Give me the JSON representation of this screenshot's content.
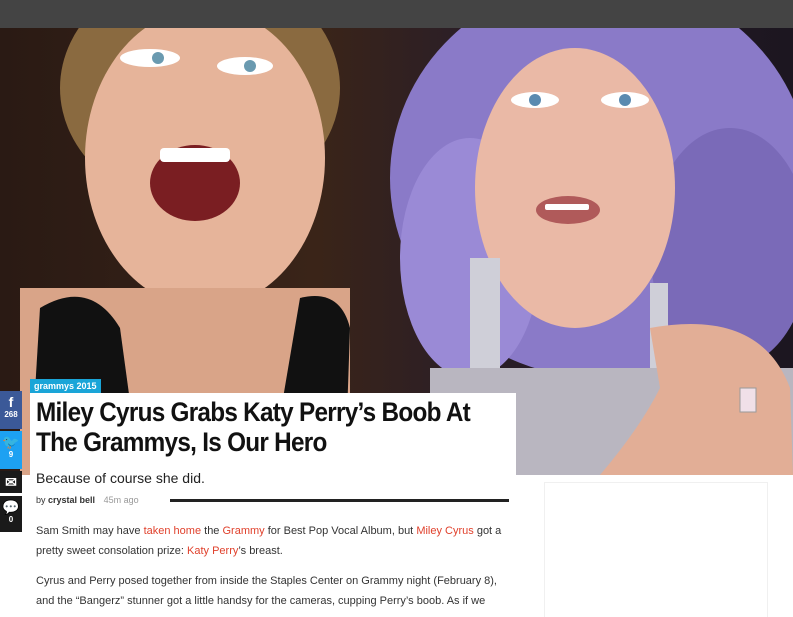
{
  "share": {
    "facebook_count": "268",
    "twitter_count": "9",
    "comments_count": "0"
  },
  "article": {
    "tag": "grammys 2015",
    "headline_line1": "Miley Cyrus Grabs Katy Perry’s Boob At",
    "headline_line2": "The Grammys, Is Our Hero",
    "dek": "Because of course she did.",
    "byline_prefix": "by",
    "author": "crystal bell",
    "time_ago": "45m ago",
    "p1": {
      "t1": "Sam Smith may have ",
      "l1": "taken home",
      "t2": " the ",
      "l2": "Grammy",
      "t3": " for Best Pop Vocal Album, but ",
      "l3": "Miley Cyrus",
      "t4": " got a pretty sweet consolation prize: ",
      "l4": "Katy Perry",
      "t5": "’s breast."
    },
    "p2": "Cyrus and Perry posed together from inside the Staples Center on Grammy night (February 8), and the “Bangerz” stunner got a little handsy for the cameras, cupping Perry’s boob. As if we"
  },
  "colors": {
    "link": "#e0412c",
    "tag_bg": "#1aa5d8",
    "facebook": "#3b5998",
    "twitter": "#1da1f2",
    "topbar": "#444444"
  },
  "icons": {
    "facebook": "facebook-icon",
    "twitter": "twitter-icon",
    "email": "email-icon",
    "comment": "comment-icon"
  }
}
